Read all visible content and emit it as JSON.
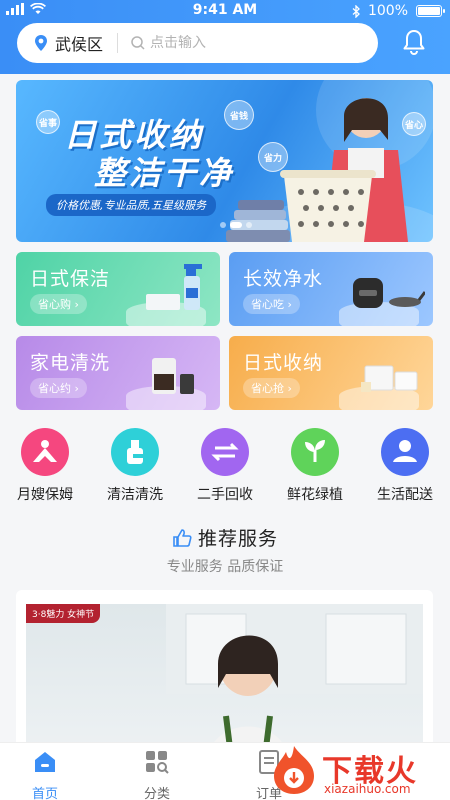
{
  "status_bar": {
    "time": "9:41 AM",
    "battery": "100%",
    "battery_level": 1.0
  },
  "header": {
    "location": "武侯区",
    "search_placeholder": "点击输入"
  },
  "banner": {
    "title_line1": "日式收纳",
    "title_line2": "整洁干净",
    "subtitle": "价格优惠,专业品质,五星级服务",
    "bubbles": [
      "省钱",
      "省力",
      "省事",
      "省心"
    ],
    "page_count": 3,
    "active_page": 1
  },
  "categories": [
    {
      "title": "日式保洁",
      "tag": "省心购",
      "color_from": "#4fd3a6",
      "color_to": "#8ee6c4"
    },
    {
      "title": "长效净水",
      "tag": "省心吃",
      "color_from": "#5a9df2",
      "color_to": "#9cc7ff"
    },
    {
      "title": "家电清洗",
      "tag": "省心约",
      "color_from": "#b78ae8",
      "color_to": "#d6b7f5"
    },
    {
      "title": "日式收纳",
      "tag": "省心抢",
      "color_from": "#f7ad4b",
      "color_to": "#ffd699"
    }
  ],
  "services": [
    {
      "label": "月嫂保姆",
      "icon": "nanny-icon",
      "color": "#f5477f"
    },
    {
      "label": "清洁清洗",
      "icon": "cleaning-icon",
      "color": "#2ed0d8"
    },
    {
      "label": "二手回收",
      "icon": "recycle-icon",
      "color": "#a166f0"
    },
    {
      "label": "鲜花绿植",
      "icon": "plant-icon",
      "color": "#5fd35a"
    },
    {
      "label": "生活配送",
      "icon": "delivery-icon",
      "color": "#4c6ef2"
    }
  ],
  "recommend": {
    "title": "推荐服务",
    "subtitle": "专业服务 品质保证",
    "badge": "3·8魅力 女神节"
  },
  "tabbar": {
    "tabs": [
      {
        "label": "首页",
        "active": true
      },
      {
        "label": "分类",
        "active": false
      },
      {
        "label": "订单",
        "active": false
      }
    ]
  },
  "watermark": {
    "main": "下载火",
    "sub": "xiazaihuo.com"
  }
}
